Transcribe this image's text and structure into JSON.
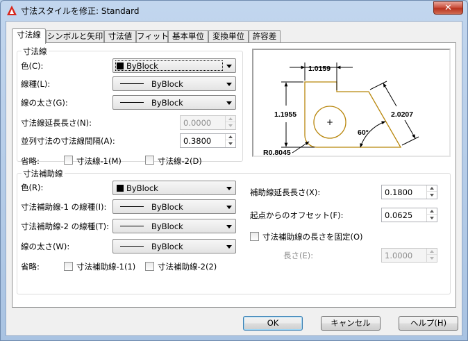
{
  "window": {
    "title": "寸法スタイルを修正: Standard",
    "close_glyph": "✕"
  },
  "tabs": [
    "寸法線",
    "シンボルと矢印",
    "寸法値",
    "フィット",
    "基本単位",
    "変換単位",
    "許容差"
  ],
  "dimension_lines": {
    "group_label": "寸法線",
    "color_label": "色(C):",
    "color_value": "ByBlock",
    "linetype_label": "線種(L):",
    "linetype_value": "ByBlock",
    "lineweight_label": "線の太さ(G):",
    "lineweight_value": "ByBlock",
    "extend_label": "寸法線延長長さ(N):",
    "extend_value": "0.0000",
    "baseline_label": "並列寸法の寸法線間隔(A):",
    "baseline_value": "0.3800",
    "suppress_label": "省略:",
    "suppress1_label": "寸法線-1(M)",
    "suppress2_label": "寸法線-2(D)"
  },
  "extension_lines": {
    "group_label": "寸法補助線",
    "color_label": "色(R):",
    "color_value": "ByBlock",
    "linetype1_label": "寸法補助線-1 の線種(I):",
    "linetype1_value": "ByBlock",
    "linetype2_label": "寸法補助線-2 の線種(T):",
    "linetype2_value": "ByBlock",
    "lineweight_label": "線の太さ(W):",
    "lineweight_value": "ByBlock",
    "suppress_label": "省略:",
    "suppress1_label": "寸法補助線-1(1)",
    "suppress2_label": "寸法補助線-2(2)",
    "extend_label": "補助線延長長さ(X):",
    "extend_value": "0.1800",
    "offset_label": "起点からのオフセット(F):",
    "offset_value": "0.0625",
    "fixed_label": "寸法補助線の長さを固定(O)",
    "length_label": "長さ(E):",
    "length_value": "1.0000"
  },
  "preview": {
    "dim_top": "1.0159",
    "dim_left": "1.1955",
    "dim_right": "2.0207",
    "dim_angle": "60°",
    "dim_radius": "R0.8045",
    "center_mark": "+",
    "shape_color": "#b8860b"
  },
  "buttons": {
    "ok": "OK",
    "cancel": "キャンセル",
    "help": "ヘルプ(H)"
  }
}
